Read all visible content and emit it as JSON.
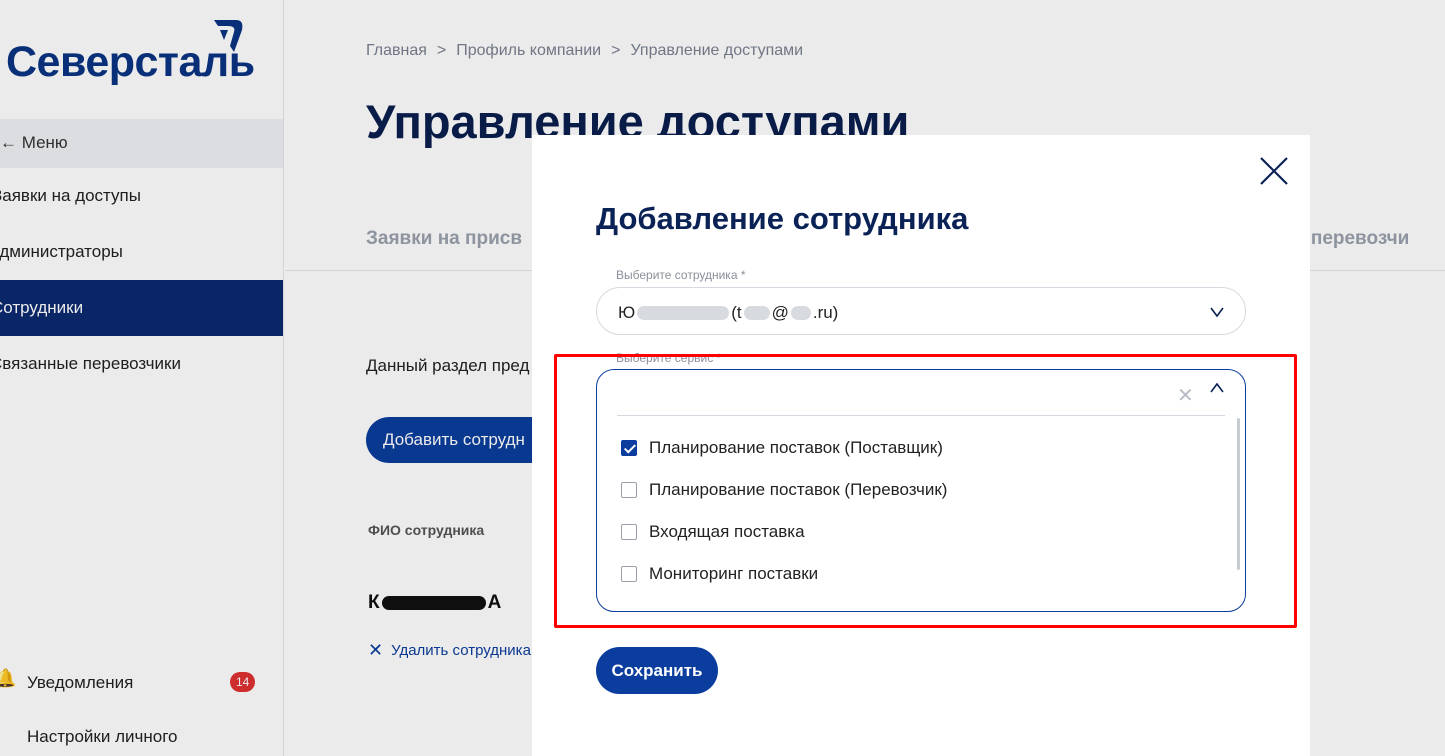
{
  "brand": {
    "name": "Северсталь",
    "color": "#0a3383",
    "logo_icon": "severstal-mark-icon"
  },
  "sidebar": {
    "menu_label": "← Меню",
    "items": [
      {
        "label": "Заявки на доступы"
      },
      {
        "label": "Администраторы"
      },
      {
        "label": "Сотрудники",
        "active": true
      },
      {
        "label": "Связанные перевозчики"
      }
    ],
    "notifications": {
      "label": "Уведомления",
      "count": "14",
      "icon": "bell-icon"
    },
    "settings_label": "Настройки личного"
  },
  "main": {
    "breadcrumb": [
      "Главная",
      ">",
      "Профиль компании",
      ">",
      "Управление доступами"
    ],
    "title": "Управление доступами",
    "tabs": [
      "Заявки на присв",
      "е перевозчи"
    ],
    "section_text": "Данный раздел пред",
    "add_button": "Добавить сотрудн",
    "column_header": "ФИО сотрудника",
    "employee": {
      "name_start": "К",
      "name_end": "А"
    },
    "delete_link": "Удалить сотрудника"
  },
  "modal": {
    "title": "Добавление сотрудника",
    "employee_field": {
      "label": "Выберите сотрудника *",
      "value_prefix": "Ю",
      "email_open": "(t",
      "email_at": "@",
      "email_suffix": ".ru)"
    },
    "service_field": {
      "label": "Выберите сервис *",
      "search_value": "",
      "options": [
        {
          "label": "Планирование поставок (Поставщик)",
          "checked": true
        },
        {
          "label": "Планирование поставок (Перевозчик)",
          "checked": false
        },
        {
          "label": "Входящая поставка",
          "checked": false
        },
        {
          "label": "Мониторинг поставки",
          "checked": false
        }
      ]
    },
    "save_button": "Сохранить"
  },
  "colors": {
    "primary": "#0a3d9e",
    "highlight": "#ff0000",
    "active_nav": "#0b2a6f"
  }
}
